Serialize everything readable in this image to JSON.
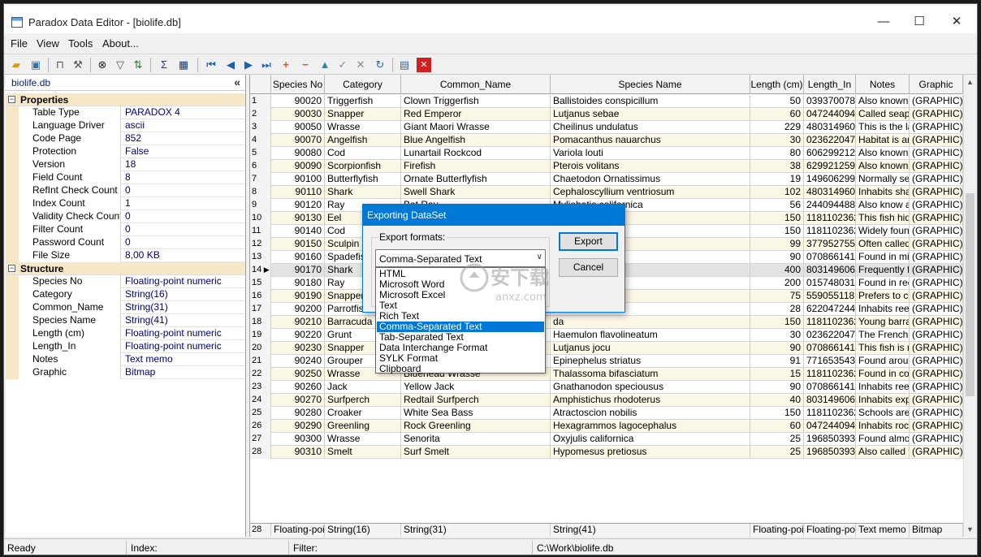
{
  "window": {
    "title": "Paradox Data Editor - [biolife.db]",
    "minimize": "—",
    "maximize": "☐",
    "close": "✕"
  },
  "menu": [
    "File",
    "View",
    "Tools",
    "About..."
  ],
  "left_panel": {
    "title": "biolife.db",
    "collapse": "«",
    "properties_label": "Properties",
    "structure_label": "Structure",
    "properties": [
      {
        "name": "Table Type",
        "value": "PARADOX 4"
      },
      {
        "name": "Language Driver",
        "value": "ascii"
      },
      {
        "name": "Code Page",
        "value": "852"
      },
      {
        "name": "Protection",
        "value": "False"
      },
      {
        "name": "Version",
        "value": "18"
      },
      {
        "name": "Field Count",
        "value": "8"
      },
      {
        "name": "RefInt Check Count",
        "value": "0"
      },
      {
        "name": "Index Count",
        "value": "1"
      },
      {
        "name": "Validity Check Count",
        "value": "0"
      },
      {
        "name": "Filter Count",
        "value": "0"
      },
      {
        "name": "Password Count",
        "value": "0"
      },
      {
        "name": "File Size",
        "value": "8,00 KB"
      }
    ],
    "structure": [
      {
        "name": "Species No",
        "value": "Floating-point numeric"
      },
      {
        "name": "Category",
        "value": "String(16)"
      },
      {
        "name": "Common_Name",
        "value": "String(31)"
      },
      {
        "name": "Species Name",
        "value": "String(41)"
      },
      {
        "name": "Length (cm)",
        "value": "Floating-point numeric"
      },
      {
        "name": "Length_In",
        "value": "Floating-point numeric"
      },
      {
        "name": "Notes",
        "value": "Text memo"
      },
      {
        "name": "Graphic",
        "value": "Bitmap"
      }
    ]
  },
  "grid": {
    "columns": [
      "Species No",
      "Category",
      "Common_Name",
      "Species Name",
      "Length (cm)",
      "Length_In",
      "Notes",
      "Graphic"
    ],
    "current_row": 14,
    "rows": [
      [
        "1",
        "90020",
        "Triggerfish",
        "Clown Triggerfish",
        "Ballistoides conspicillum",
        "50",
        "0393700787",
        "Also known a",
        "(GRAPHIC)"
      ],
      [
        "2",
        "90030",
        "Snapper",
        "Red Emperor",
        "Lutjanus sebae",
        "60",
        "0472440945",
        "Called seape",
        "(GRAPHIC)"
      ],
      [
        "3",
        "90050",
        "Wrasse",
        "Giant Maori Wrasse",
        "Cheilinus undulatus",
        "229",
        "4803149606",
        "This is the lar",
        "(GRAPHIC)"
      ],
      [
        "4",
        "90070",
        "Angelfish",
        "Blue Angelfish",
        "Pomacanthus nauarchus",
        "30",
        "0236220472",
        "Habitat is arc",
        "(GRAPHIC)"
      ],
      [
        "5",
        "90080",
        "Cod",
        "Lunartail Rockcod",
        "Variola louti",
        "80",
        "6062992126",
        "Also known a",
        "(GRAPHIC)"
      ],
      [
        "6",
        "90090",
        "Scorpionfish",
        "Firefish",
        "Pterois volitans",
        "38",
        "6299212598",
        "Also known a",
        "(GRAPHIC)"
      ],
      [
        "7",
        "90100",
        "Butterflyfish",
        "Ornate Butterflyfish",
        "Chaetodon Ornatissimus",
        "19",
        "1496062992",
        "Normally see",
        "(GRAPHIC)"
      ],
      [
        "8",
        "90110",
        "Shark",
        "Swell Shark",
        "Cephaloscyllium ventriosum",
        "102",
        "4803149606",
        "Inhabits shal",
        "(GRAPHIC)"
      ],
      [
        "9",
        "90120",
        "Ray",
        "Bat Ray",
        "Myliobatis californica",
        "56",
        "2440944882",
        "Also know as",
        "(GRAPHIC)"
      ],
      [
        "10",
        "90130",
        "Eel",
        "",
        "ax",
        "150",
        "1181102362",
        "This fish hide",
        "(GRAPHIC)"
      ],
      [
        "11",
        "90140",
        "Cod",
        "",
        "s",
        "150",
        "1181102362",
        "Widely found",
        "(GRAPHIC)"
      ],
      [
        "12",
        "90150",
        "Sculpin",
        "",
        "armoratus",
        "99",
        "3779527559",
        "Often called",
        "(GRAPHIC)"
      ],
      [
        "13",
        "90160",
        "Spadefish",
        "",
        "er",
        "90",
        "0708661417",
        "Found in mid",
        "(GRAPHIC)"
      ],
      [
        "14",
        "90170",
        "Shark",
        "",
        "atum",
        "400",
        "8031496063",
        "Frequently fo",
        "(GRAPHIC)"
      ],
      [
        "15",
        "90180",
        "Ray",
        "",
        "",
        "200",
        "0157480315",
        "Found in ree",
        "(GRAPHIC)"
      ],
      [
        "16",
        "90190",
        "Snapper",
        "",
        "",
        "75",
        "5590551181",
        "Prefers to co",
        "(GRAPHIC)"
      ],
      [
        "17",
        "90200",
        "Parrotfish",
        "",
        "natum",
        "28",
        "6220472441",
        "Inhabits reef",
        "(GRAPHIC)"
      ],
      [
        "18",
        "90210",
        "Barracuda",
        "",
        "da",
        "150",
        "1181102362",
        "Young barrac",
        "(GRAPHIC)"
      ],
      [
        "19",
        "90220",
        "Grunt",
        "",
        "Haemulon flavolineatum",
        "30",
        "0236220472",
        "The French g",
        "(GRAPHIC)"
      ],
      [
        "20",
        "90230",
        "Snapper",
        "",
        "Lutjanus jocu",
        "90",
        "0708661417",
        "This fish is na",
        "(GRAPHIC)"
      ],
      [
        "21",
        "90240",
        "Grouper",
        "",
        "Epinephelus striatus",
        "91",
        "7716535433",
        "Found aroun",
        "(GRAPHIC)"
      ],
      [
        "22",
        "90250",
        "Wrasse",
        "Bluehead Wrasse",
        "Thalassoma bifasciatum",
        "15",
        "1181102362",
        "Found in coi",
        "(GRAPHIC)"
      ],
      [
        "23",
        "90260",
        "Jack",
        "Yellow Jack",
        "Gnathanodon speciousus",
        "90",
        "0708661417",
        "Inhabits reef",
        "(GRAPHIC)"
      ],
      [
        "24",
        "90270",
        "Surfperch",
        "Redtail Surfperch",
        "Amphistichus rhodoterus",
        "40",
        "8031496063",
        "Inhabits expo",
        "(GRAPHIC)"
      ],
      [
        "25",
        "90280",
        "Croaker",
        "White Sea Bass",
        "Atractoscion nobilis",
        "150",
        "1181102362",
        "Schools are f",
        "(GRAPHIC)"
      ],
      [
        "26",
        "90290",
        "Greenling",
        "Rock Greenling",
        "Hexagrammos lagocephalus",
        "60",
        "0472440945",
        "Inhabits rock",
        "(GRAPHIC)"
      ],
      [
        "27",
        "90300",
        "Wrasse",
        "Senorita",
        "Oxyjulis californica",
        "25",
        "1968503937",
        "Found almos",
        "(GRAPHIC)"
      ],
      [
        "28",
        "90310",
        "Smelt",
        "Surf Smelt",
        "Hypomesus pretiosus",
        "25",
        "1968503937",
        "Also called th",
        "(GRAPHIC)"
      ]
    ],
    "footer": [
      "28",
      "Floating-poir",
      "String(16)",
      "String(31)",
      "String(41)",
      "Floating-poir",
      "Floating-poir",
      "Text memo",
      "Bitmap"
    ]
  },
  "status": {
    "state": "Ready",
    "index_label": "Index:",
    "filter_label": "Filter:",
    "path": "C:\\Work\\biolife.db"
  },
  "dialog": {
    "title": "Exporting DataSet",
    "formats_label": "Export formats:",
    "selected_format": "Comma-Separated Text",
    "export_button": "Export",
    "cancel_button": "Cancel",
    "formats": [
      "HTML",
      "Microsoft Word",
      "Microsoft Excel",
      "Text",
      "Rich Text",
      "Comma-Separated Text",
      "Tab-Separated Text",
      "Data Interchange Format",
      "SYLK Format",
      "Clipboard"
    ]
  },
  "watermark": {
    "cn": "安下载",
    "en": "anxz.com"
  },
  "colors": {
    "accent": "#0078d7",
    "row_alt": "#fcf6e5",
    "section_bg": "#f6e7c6",
    "value_text": "#00007a"
  }
}
